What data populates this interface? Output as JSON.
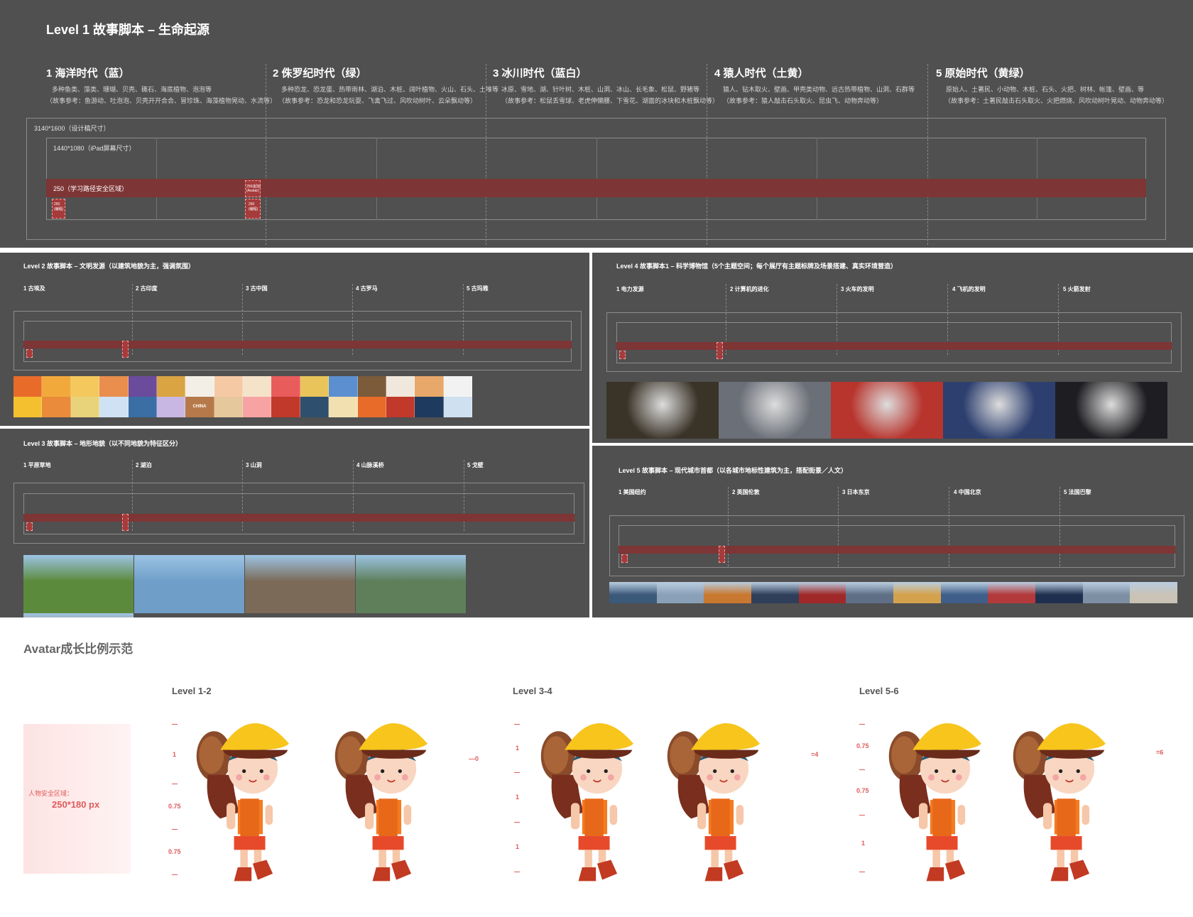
{
  "level1": {
    "title": "Level 1 故事脚本 – 生命起源",
    "eras": [
      {
        "name": "1 海洋时代（蓝）",
        "line1": "多种鱼类、藻类、珊瑚、贝壳、礁石、海底植物、泡泡等",
        "line2": "（故事参考：鱼游动、吐泡泡、贝壳开开合合、冒珍珠、海藻植物晃动、水流等）"
      },
      {
        "name": "2 侏罗纪时代（绿）",
        "line1": "多种恐龙、恐龙蛋、热带雨林、湖泊、木桩、阔叶植物、火山、石头、土堆等",
        "line2": "（故事参考：恐龙和恐龙玩耍、飞禽飞过、风吹动树叶、云朵飘动等）"
      },
      {
        "name": "3 冰川时代（蓝白）",
        "line1": "冰原、雪地、湖、针叶树、木桩、山洞、冰山、长毛象、松鼠、野猪等",
        "line2": "（故事参考：松鼠丢雪球、老虎伸懒腰、下雪花、湖面的冰块和木桩飘动等）"
      },
      {
        "name": "4 猿人时代（土黄）",
        "line1": "猿人、钻木取火、壁画、甲壳类动物、远古热带植物、山洞、石群等",
        "line2": "（故事参考：猿人敲击石头取火、昆虫飞、动物奔动等）"
      },
      {
        "name": "5 原始时代（黄绿）",
        "line1": "原始人、土著民、小动物、木桩、石头、火把、树林、帐篷、壁画、等",
        "line2": "（故事参考：土著民敲击石头取火、火把燃烧、风吹动树叶晃动、动物奔动等）"
      }
    ],
    "design_size": "3140*1600（设计稿尺寸）",
    "ipad_size": "1440*1080（iPad屏幕尺寸）",
    "safe_band": "250（学习路径安全区域）",
    "marker_left": "250\n(编程)",
    "marker_right_top": "250(起始\n(Avatar)",
    "marker_right": "250\n(编程)"
  },
  "level2": {
    "title": "Level 2 故事脚本 – 文明发源（以建筑地貌为主，强调氛围）",
    "eras": [
      "1 古埃及",
      "2 古印度",
      "3 古中国",
      "4 古罗马",
      "5 古玛雅"
    ],
    "thumb_colors": [
      "#e86b2a",
      "#f2a93b",
      "#f4c85c",
      "#e98e4c",
      "#6b4b9b",
      "#d9a441",
      "#f3efe6",
      "#f6c9a5",
      "#f4e2c9",
      "#e95c5c",
      "#e8c45a",
      "#5b8fcf",
      "#7b5b3a",
      "#f0e8dc",
      "#e7a86a",
      "#f2f2f2",
      "#f4c030",
      "#e98b3a",
      "#e9d37a",
      "#cfe2f3",
      "#3a6ea5",
      "#c9b7e3",
      "#b67a4a",
      "#e5c89b",
      "#f7a3a3",
      "#c0392b",
      "#2f4f6f",
      "#f2e0b0",
      "#e86b2a",
      "#c0392b",
      "#1f3a5f",
      "#cfe0f0"
    ],
    "china_label": "CHINA"
  },
  "level3": {
    "title": "Level 3 故事脚本 – 地形地貌（以不同地貌为特征区分）",
    "eras": [
      "1 平原草地",
      "2 湖泊",
      "3 山洞",
      "4 山脉溪桥",
      "5 戈壁"
    ],
    "photo_colors": [
      "#5c8a3c",
      "#6f9fc8",
      "#7b6a58",
      "#5e7f5a",
      "#c0652f"
    ]
  },
  "level4": {
    "title": "Level 4 故事脚本1 – 科学博物馆（5个主题空间；每个展厅有主题标牌及场景搭建、真实环境营造）",
    "eras": [
      "1 电力发源",
      "2 计算机的进化",
      "3 火车的发明",
      "4 飞机的发明",
      "5 火箭发射"
    ],
    "photo_colors": [
      "#3a3328",
      "#6b6f78",
      "#b8352e",
      "#2d3f6f",
      "#1e1e22"
    ]
  },
  "level5": {
    "title": "Level 5 故事脚本 – 现代城市首都（以各城市地标性建筑为主，搭配街景／人文）",
    "eras": [
      "1 美国纽约",
      "2 英国伦敦",
      "3 日本东京",
      "4 中国北京",
      "5 法国巴黎"
    ],
    "city_colors": [
      "#3b5a7a",
      "#8aa0b8",
      "#c8782f",
      "#2f3f5a",
      "#a02828",
      "#5e6f86",
      "#d4a24c",
      "#3f5e8a",
      "#b33a3a",
      "#1f2f4f",
      "#7d8fa3",
      "#c9c2b5"
    ]
  },
  "avatar": {
    "section_title": "Avatar成长比例示范",
    "safe_label": "人物安全区域：",
    "safe_size": "250*180 px",
    "groups": [
      {
        "label": "Level 1-2",
        "ruler": [
          "1",
          "0.75",
          "0.75"
        ],
        "right": "0"
      },
      {
        "label": "Level 3-4",
        "ruler": [
          "1",
          "1",
          "1"
        ],
        "right": "4"
      },
      {
        "label": "Level 5-6",
        "ruler": [
          "0.75",
          "0.75",
          "1"
        ],
        "right": "6"
      }
    ]
  },
  "colors": {
    "panel_bg": "#505050",
    "safe_band": "#7e3535",
    "accent_red": "#e05a5a",
    "hat_yellow": "#f7c51c",
    "vest_orange": "#f47b20"
  }
}
